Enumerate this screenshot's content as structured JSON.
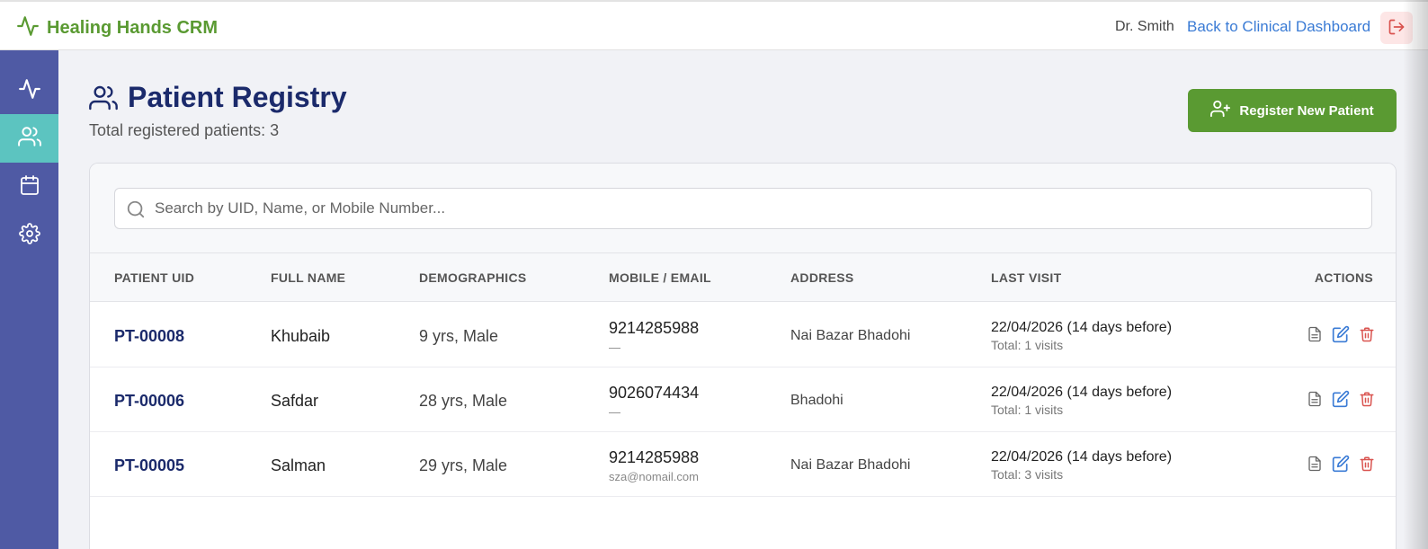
{
  "app": {
    "title": "Healing Hands CRM",
    "brand_color": "#5a9a32"
  },
  "header": {
    "user": "Dr. Smith",
    "back_link": "Back to Clinical Dashboard",
    "logout_icon": "logout-icon"
  },
  "sidebar": {
    "items": [
      {
        "icon": "activity-icon",
        "active": false
      },
      {
        "icon": "users-icon",
        "active": true
      },
      {
        "icon": "calendar-icon",
        "active": false
      },
      {
        "icon": "gear-icon",
        "active": false
      }
    ]
  },
  "page": {
    "title": "Patient Registry",
    "subtitle": "Total registered patients: 3",
    "register_button": "Register New Patient"
  },
  "search": {
    "placeholder": "Search by UID, Name, or Mobile Number...",
    "value": ""
  },
  "table": {
    "headers": [
      "PATIENT UID",
      "FULL NAME",
      "DEMOGRAPHICS",
      "MOBILE / EMAIL",
      "ADDRESS",
      "LAST VISIT",
      "ACTIONS"
    ],
    "rows": [
      {
        "uid": "PT-00008",
        "name": "Khubaib",
        "demographics": "9 yrs, Male",
        "mobile": "9214285988",
        "email": "—",
        "address": "Nai Bazar Bhadohi",
        "last_visit": "22/04/2026 (14 days before)",
        "total": "Total: 1 visits"
      },
      {
        "uid": "PT-00006",
        "name": "Safdar",
        "demographics": "28 yrs, Male",
        "mobile": "9026074434",
        "email": "—",
        "address": "Bhadohi",
        "last_visit": "22/04/2026 (14 days before)",
        "total": "Total: 1 visits"
      },
      {
        "uid": "PT-00005",
        "name": "Salman",
        "demographics": "29 yrs, Male",
        "mobile": "9214285988",
        "email": "sza@nomail.com",
        "address": "Nai Bazar Bhadohi",
        "last_visit": "22/04/2026 (14 days before)",
        "total": "Total: 3 visits"
      }
    ]
  },
  "colors": {
    "sidebar": "#4f5aa4",
    "sidebar_active": "#5cc4c0",
    "title": "#1b2a6b",
    "link": "#3a7bd5",
    "delete": "#d9534f"
  }
}
